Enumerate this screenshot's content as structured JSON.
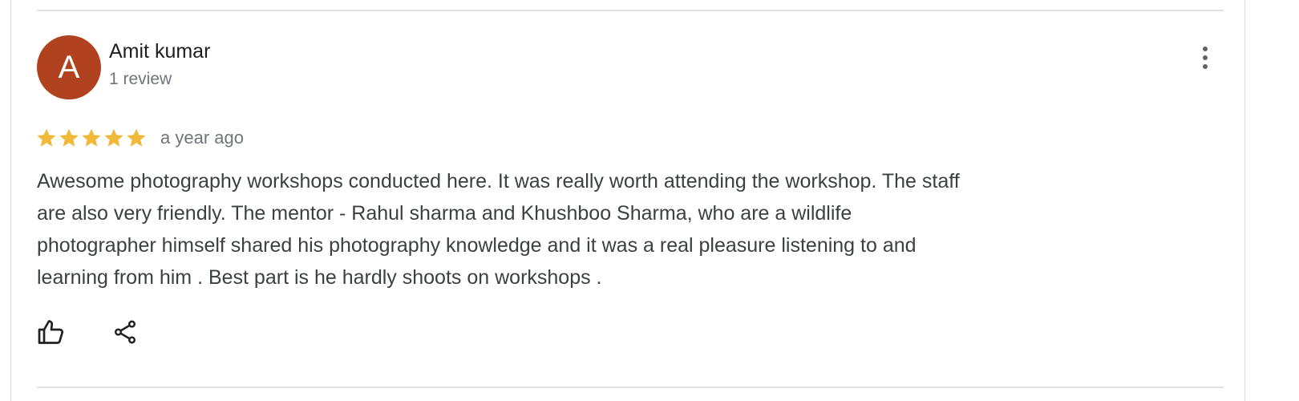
{
  "review": {
    "author": {
      "initial": "A",
      "name": "Amit kumar",
      "review_count": "1 review",
      "avatar_color": "#b0421f"
    },
    "rating": 5,
    "rating_max": 5,
    "star_color": "#f0b93a",
    "time_ago": "a year ago",
    "text_lines": [
      "Awesome photography workshops conducted here. It was really worth attending the workshop. The staff",
      "are also very friendly. The mentor - Rahul sharma and Khushboo Sharma, who are a wildlife",
      "photographer himself shared his photography knowledge and it was a real pleasure listening to and",
      "learning from him . Best part is he hardly shoots on workshops ."
    ],
    "actions": {
      "like_icon": "thumbs-up-icon",
      "share_icon": "share-icon",
      "more_icon": "more-vert-icon"
    }
  }
}
